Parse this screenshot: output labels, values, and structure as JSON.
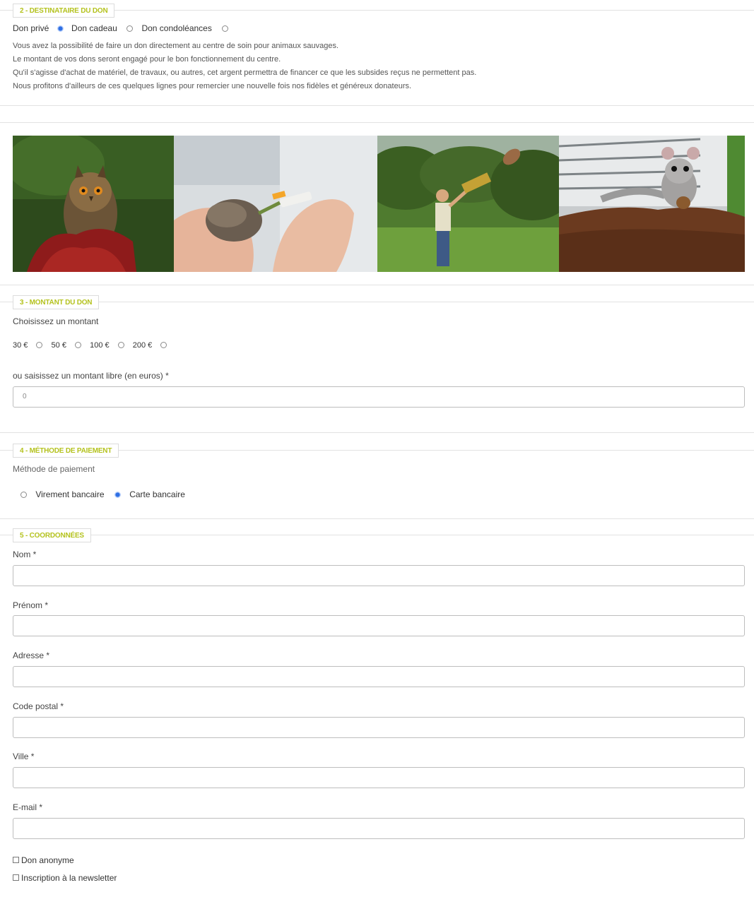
{
  "section2": {
    "legend": "2 - DESTINATAIRE DU DON",
    "options": [
      {
        "label": "Don privé",
        "checked": true
      },
      {
        "label": "Don cadeau",
        "checked": false
      },
      {
        "label": "Don condoléances",
        "checked": false
      }
    ],
    "description": [
      "Vous avez la possibilité de faire un don directement au centre de soin pour animaux sauvages.",
      "Le montant de vos dons seront engagé pour le bon fonctionnement du centre.",
      "Qu'il s'agisse d'achat de matériel, de travaux, ou autres, cet argent permettra de financer ce que les subsides reçus ne permettent pas.",
      "Nous profitons d'ailleurs de ces quelques lignes pour remercier une nouvelle fois nos fidèles et généreux donateurs."
    ]
  },
  "photos": {
    "items": [
      {
        "name": "owl-photo"
      },
      {
        "name": "hedgehog-photo"
      },
      {
        "name": "bird-release-photo"
      },
      {
        "name": "dormouse-photo"
      }
    ]
  },
  "section3": {
    "legend": "3 - MONTANT DU DON",
    "choose_label": "Choisissez un montant",
    "amounts": [
      {
        "label": "30 €",
        "checked": false
      },
      {
        "label": "50 €",
        "checked": false
      },
      {
        "label": "100 €",
        "checked": false
      },
      {
        "label": "200 €",
        "checked": false
      }
    ],
    "free_amount_label": "ou saisissez un montant libre (en euros) *",
    "free_amount_value": "0"
  },
  "section4": {
    "legend": "4 - MÉTHODE DE PAIEMENT",
    "method_label": "Méthode de paiement",
    "options": [
      {
        "label": "Virement bancaire",
        "checked": false
      },
      {
        "label": "Carte bancaire",
        "checked": true
      }
    ]
  },
  "section5": {
    "legend": "5 - COORDONNÉES",
    "fields": {
      "nom": {
        "label": "Nom *",
        "value": ""
      },
      "prenom": {
        "label": "Prénom *",
        "value": ""
      },
      "adresse": {
        "label": "Adresse *",
        "value": ""
      },
      "code_postal": {
        "label": "Code postal *",
        "value": ""
      },
      "ville": {
        "label": "Ville *",
        "value": ""
      },
      "email": {
        "label": "E-mail *",
        "value": ""
      }
    },
    "checkboxes": {
      "anonyme": {
        "label": "Don anonyme",
        "checked": false
      },
      "newsletter": {
        "label": "Inscription à la newsletter",
        "checked": false
      }
    }
  },
  "colors": {
    "legend_text": "#b4c21e",
    "radio_selected": "#2f6fe4",
    "border": "#bdbdbd"
  }
}
